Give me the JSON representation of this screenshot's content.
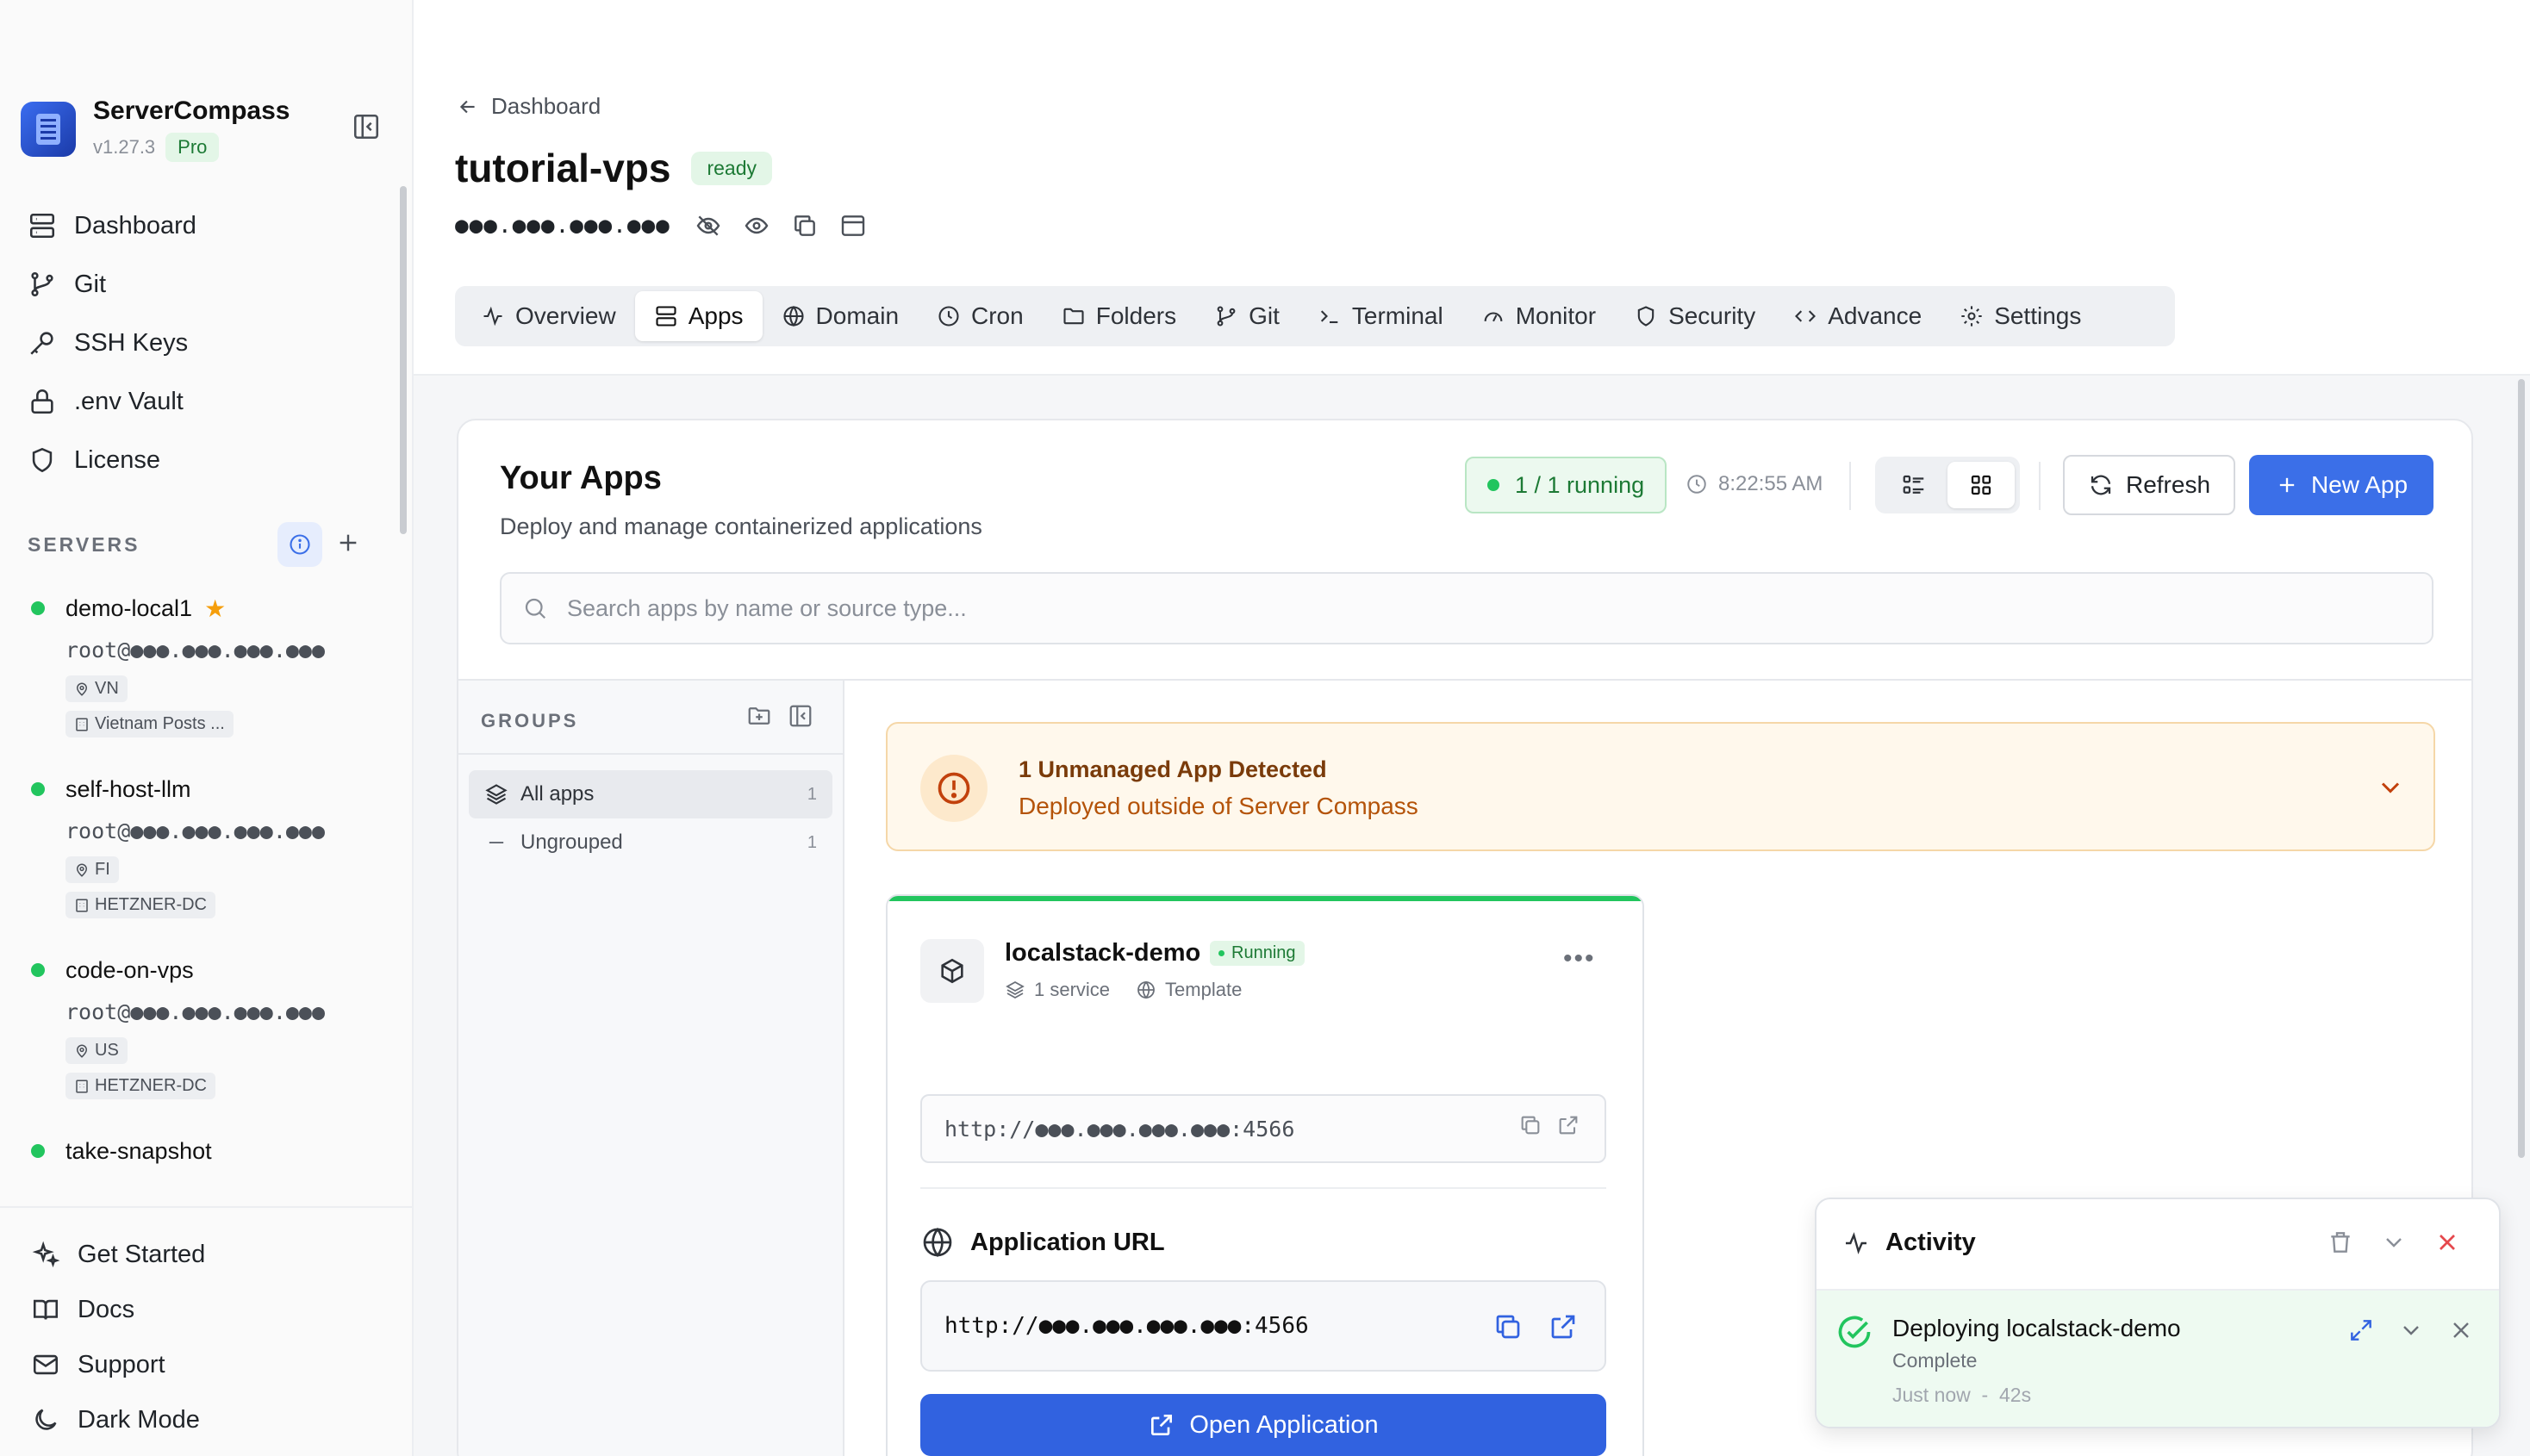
{
  "app": {
    "name": "ServerCompass",
    "version": "v1.27.3",
    "plan": "Pro"
  },
  "sidebar": {
    "nav": [
      {
        "label": "Dashboard",
        "icon": "server-icon"
      },
      {
        "label": "Git",
        "icon": "git-branch-icon"
      },
      {
        "label": "SSH Keys",
        "icon": "key-icon"
      },
      {
        "label": ".env Vault",
        "icon": "lock-icon"
      },
      {
        "label": "License",
        "icon": "shield-icon"
      }
    ],
    "servers_title": "SERVERS",
    "servers": [
      {
        "name": "demo-local1",
        "host": "root@●●●.●●●.●●●.●●●",
        "country": "VN",
        "provider": "Vietnam Posts ...",
        "favorite": true,
        "status_color": "#22c55e"
      },
      {
        "name": "self-host-llm",
        "host": "root@●●●.●●●.●●●.●●●",
        "country": "FI",
        "provider": "HETZNER-DC",
        "favorite": false,
        "status_color": "#22c55e"
      },
      {
        "name": "code-on-vps",
        "host": "root@●●●.●●●.●●●.●●●",
        "country": "US",
        "provider": "HETZNER-DC",
        "favorite": false,
        "status_color": "#22c55e"
      },
      {
        "name": "take-snapshot",
        "status_color": "#22c55e"
      }
    ],
    "bottom": [
      {
        "label": "Get Started",
        "icon": "sparkles-icon"
      },
      {
        "label": "Docs",
        "icon": "book-icon"
      },
      {
        "label": "Support",
        "icon": "mail-icon"
      },
      {
        "label": "Dark Mode",
        "icon": "moon-icon"
      }
    ]
  },
  "header": {
    "breadcrumb": "Dashboard",
    "server_title": "tutorial-vps",
    "status": "ready",
    "ip_masked": "●●●.●●●.●●●.●●●"
  },
  "tabs": [
    {
      "label": "Overview",
      "icon": "activity-icon"
    },
    {
      "label": "Apps",
      "icon": "server-icon",
      "active": true
    },
    {
      "label": "Domain",
      "icon": "globe-icon"
    },
    {
      "label": "Cron",
      "icon": "clock-icon"
    },
    {
      "label": "Folders",
      "icon": "folder-icon"
    },
    {
      "label": "Git",
      "icon": "git-branch-icon"
    },
    {
      "label": "Terminal",
      "icon": "terminal-icon"
    },
    {
      "label": "Monitor",
      "icon": "gauge-icon"
    },
    {
      "label": "Security",
      "icon": "shield-icon"
    },
    {
      "label": "Advance",
      "icon": "code-icon"
    },
    {
      "label": "Settings",
      "icon": "gear-icon"
    }
  ],
  "apps": {
    "title": "Your Apps",
    "subtitle": "Deploy and manage containerized applications",
    "running": "1 / 1 running",
    "last_updated": "8:22:55 AM",
    "refresh_label": "Refresh",
    "new_app_label": "New App",
    "search_placeholder": "Search apps by name or source type...",
    "accent": "#3b6fe8"
  },
  "groups": {
    "title": "GROUPS",
    "items": [
      {
        "label": "All apps",
        "count": "1",
        "active": true
      },
      {
        "label": "Ungrouped",
        "count": "1",
        "active": false
      }
    ]
  },
  "unmanaged": {
    "title": "1 Unmanaged App Detected",
    "subtitle": "Deployed outside of Server Compass"
  },
  "app_card": {
    "name": "localstack-demo",
    "status": "Running",
    "services": "1 service",
    "source": "Template",
    "internal_url": "http://●●●.●●●.●●●.●●●:4566",
    "application_url_title": "Application URL",
    "application_url": "http://●●●.●●●.●●●.●●●:4566",
    "open_label": "Open Application"
  },
  "activity": {
    "title": "Activity",
    "item_title": "Deploying localstack-demo",
    "item_status": "Complete",
    "item_time": "Just now",
    "item_separator": "-",
    "item_duration": "42s"
  }
}
